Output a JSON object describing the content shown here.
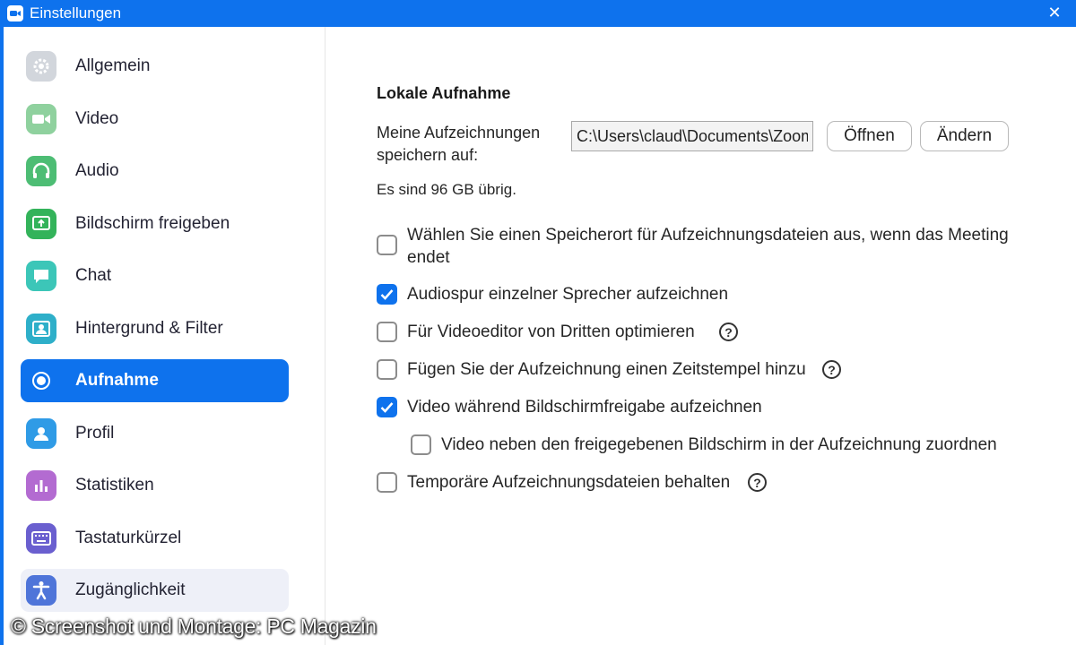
{
  "window": {
    "title": "Einstellungen",
    "close_symbol": "✕"
  },
  "sidebar": {
    "items": [
      {
        "label": "Allgemein",
        "icon": "gear-icon",
        "color": "#d2d6dc"
      },
      {
        "label": "Video",
        "icon": "video-camera-icon",
        "color": "#8fd19e"
      },
      {
        "label": "Audio",
        "icon": "headphones-icon",
        "color": "#4dbd74"
      },
      {
        "label": "Bildschirm freigeben",
        "icon": "share-screen-icon",
        "color": "#33b35a"
      },
      {
        "label": "Chat",
        "icon": "chat-bubble-icon",
        "color": "#3cc6b8"
      },
      {
        "label": "Hintergrund & Filter",
        "icon": "background-person-icon",
        "color": "#2eafc9"
      },
      {
        "label": "Aufnahme",
        "icon": "record-icon",
        "color": "#0e72ed",
        "active": true
      },
      {
        "label": "Profil",
        "icon": "profile-icon",
        "color": "#2f9be6"
      },
      {
        "label": "Statistiken",
        "icon": "statistics-icon",
        "color": "#b36bd1"
      },
      {
        "label": "Tastaturkürzel",
        "icon": "keyboard-icon",
        "color": "#6a5fcf"
      },
      {
        "label": "Zugänglichkeit",
        "icon": "accessibility-icon",
        "color": "#4f75d9"
      }
    ]
  },
  "recording": {
    "section_title": "Lokale Aufnahme",
    "save_label": "Meine Aufzeichnungen speichern auf:",
    "path_value": "C:\\Users\\claud\\Documents\\Zoom",
    "open_button": "Öffnen",
    "change_button": "Ändern",
    "free_space": "Es sind 96 GB übrig.",
    "options": [
      {
        "label": "Wählen Sie einen Speicherort für Aufzeichnungsdateien aus, wenn das Meeting endet",
        "checked": false,
        "help": false
      },
      {
        "label": "Audiospur einzelner Sprecher aufzeichnen",
        "checked": true,
        "help": false
      },
      {
        "label": "Für Videoeditor von Dritten optimieren",
        "checked": false,
        "help": true
      },
      {
        "label": "Fügen Sie der Aufzeichnung einen Zeitstempel hinzu",
        "checked": false,
        "help": true
      },
      {
        "label": "Video während Bildschirmfreigabe aufzeichnen",
        "checked": true,
        "help": false
      },
      {
        "label": "Video neben den freigegebenen Bildschirm in der Aufzeichnung zuordnen",
        "checked": false,
        "help": false
      },
      {
        "label": "Temporäre Aufzeichnungsdateien behalten",
        "checked": false,
        "help": true
      }
    ],
    "help_symbol": "?"
  },
  "watermark": "© Screenshot und Montage: PC Magazin",
  "colors": {
    "accent": "#0e72ed"
  }
}
